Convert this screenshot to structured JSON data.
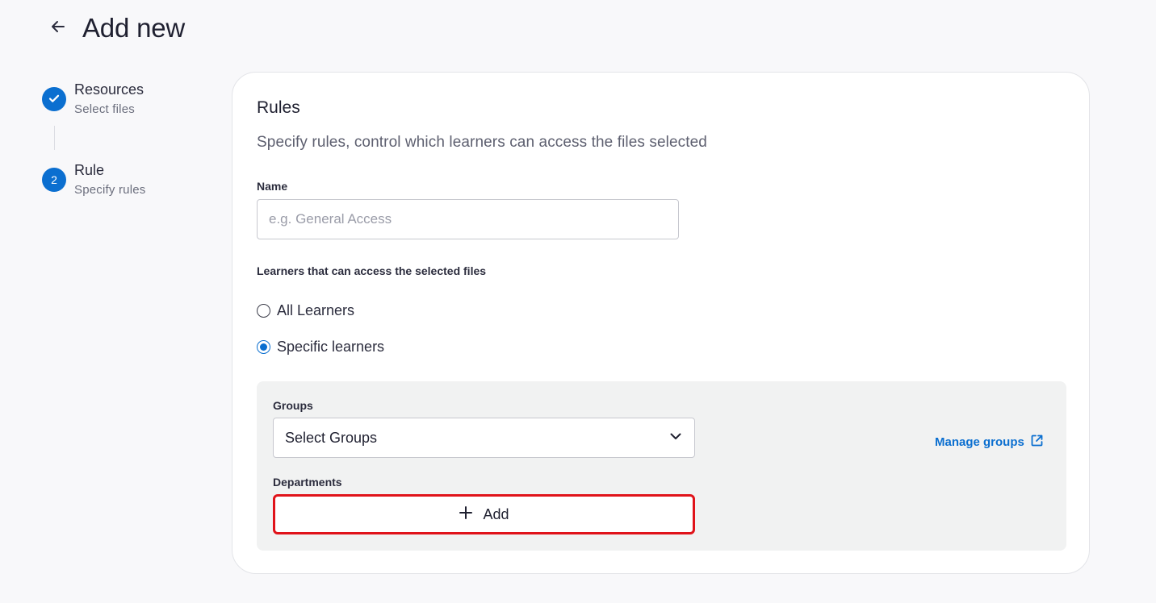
{
  "header": {
    "title": "Add new"
  },
  "stepper": {
    "steps": [
      {
        "title": "Resources",
        "subtitle": "Select files",
        "state": "done"
      },
      {
        "title": "Rule",
        "subtitle": "Specify rules",
        "number": "2",
        "state": "active"
      }
    ]
  },
  "card": {
    "title": "Rules",
    "subtitle": "Specify rules, control which learners can access the files selected",
    "name_field": {
      "label": "Name",
      "value": "",
      "placeholder": "e.g. General Access"
    },
    "access": {
      "label": "Learners that can access the selected files",
      "options": [
        {
          "label": "All Learners",
          "checked": false
        },
        {
          "label": "Specific learners",
          "checked": true
        }
      ]
    },
    "groups": {
      "label": "Groups",
      "value": "Select Groups",
      "manage_label": "Manage groups"
    },
    "departments": {
      "label": "Departments",
      "add_label": "Add"
    }
  },
  "colors": {
    "accent": "#0b6fd0",
    "highlight": "#e0131a",
    "panel": "#f1f2f2"
  },
  "icons": [
    "back-arrow-icon",
    "check-icon",
    "chevron-down-icon",
    "external-link-icon",
    "plus-icon"
  ]
}
